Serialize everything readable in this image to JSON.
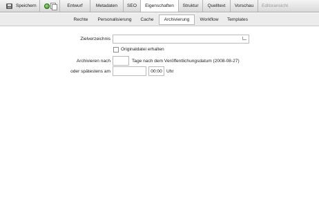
{
  "toolbar": {
    "save_label": "Speichern",
    "tabs": [
      {
        "label": "Entwurf"
      },
      {
        "label": "Metadaten"
      },
      {
        "label": "SEO"
      },
      {
        "label": "Eigenschaften"
      },
      {
        "label": "Struktur"
      },
      {
        "label": "Quelltext"
      },
      {
        "label": "Vorschau"
      },
      {
        "label": "Editoransicht"
      }
    ]
  },
  "subtabs": [
    {
      "label": "Rechte"
    },
    {
      "label": "Personalisierung"
    },
    {
      "label": "Cache"
    },
    {
      "label": "Archivierung"
    },
    {
      "label": "Workflow"
    },
    {
      "label": "Templates"
    }
  ],
  "form": {
    "target_label": "Zielverzeichnis",
    "target_value": "",
    "keep_original_label": "Originaldatei erhalten",
    "keep_original_checked": false,
    "archive_after_label": "Archivieren nach",
    "archive_after_value": "",
    "days_text": "Tage nach dem Veröffentlichungsdatum (2008-08-27)",
    "latest_label": "oder spätestens am",
    "latest_date_value": "",
    "time_value": "00:00",
    "time_unit": "Uhr"
  }
}
